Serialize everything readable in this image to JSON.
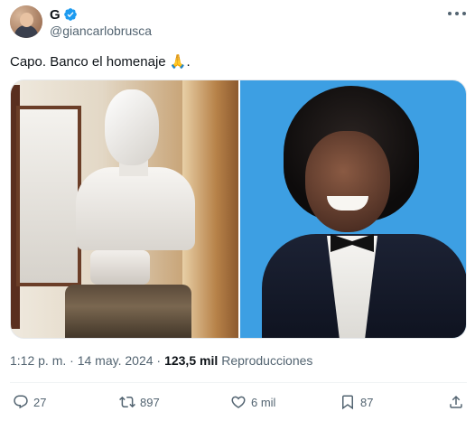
{
  "author": {
    "display_name": "G",
    "handle": "@giancarlobrusca",
    "verified": true
  },
  "tweet": {
    "text": "Capo. Banco el homenaje ",
    "emoji": "🙏",
    "trailing": "."
  },
  "media": {
    "count": 2
  },
  "meta": {
    "time": "1:12 p. m.",
    "separator": "·",
    "date": "14 may. 2024",
    "views": "123,5 mil",
    "views_label": "Reproducciones"
  },
  "actions": {
    "replies": "27",
    "reposts": "897",
    "likes": "6 mil",
    "bookmarks": "87"
  },
  "colors": {
    "verified_badge": "#1d9bf0",
    "secondary_text": "#536471"
  }
}
